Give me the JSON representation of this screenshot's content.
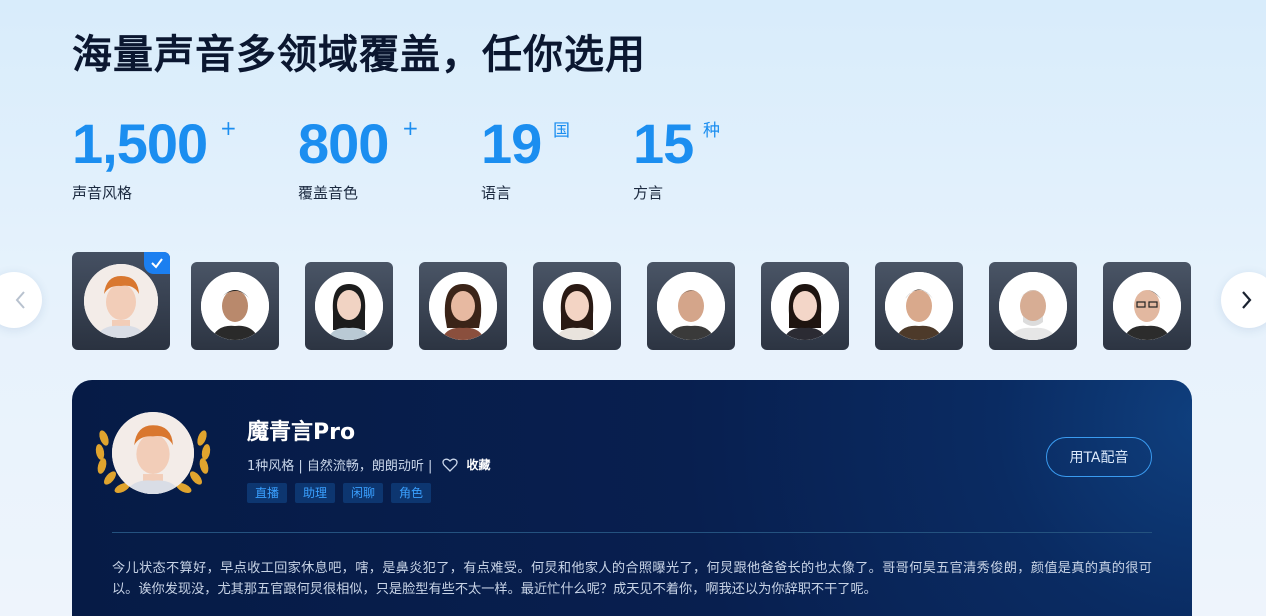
{
  "headline": "海量声音多领域覆盖，任你选用",
  "stats": [
    {
      "number": "1,500",
      "suffix": "+",
      "label": "声音风格"
    },
    {
      "number": "800",
      "suffix": "+",
      "label": "覆盖音色"
    },
    {
      "number": "19",
      "suffix": "国",
      "label": "语言"
    },
    {
      "number": "15",
      "suffix": "种",
      "label": "方言"
    }
  ],
  "carousel": {
    "prev_icon": "chevron-left-icon",
    "next_icon": "chevron-right-icon"
  },
  "selected_voice": {
    "name": "魔青言Pro",
    "meta": "1种风格 | 自然流畅，朗朗动听 |",
    "favorite_label": "收藏",
    "tags": [
      "直播",
      "助理",
      "闲聊",
      "角色"
    ],
    "use_button": "用TA配音",
    "sample_text": "今儿状态不算好，早点收工回家休息吧，嗐，是鼻炎犯了，有点难受。何炅和他家人的合照曝光了，何炅跟他爸爸长的也太像了。哥哥何昊五官清秀俊朗，颜值是真的真的很可以。诶你发现没，尤其那五官跟何炅很相似，只是脸型有些不太一样。最近忙什么呢？成天见不着你，啊我还以为你辞职不干了呢。"
  },
  "colors": {
    "accent": "#1b8ef0",
    "panel_bg": "#061b46",
    "tag_text": "#3aa0ff",
    "check_badge": "#1b7ff0"
  }
}
